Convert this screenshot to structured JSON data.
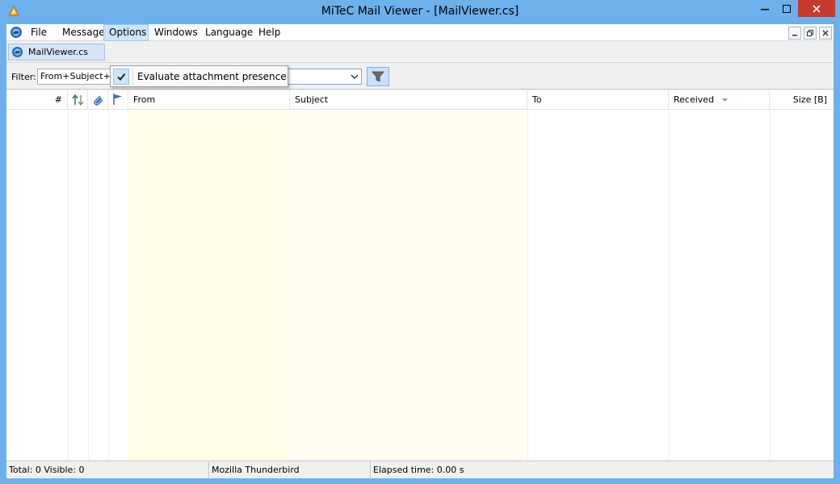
{
  "window": {
    "title": "MiTeC Mail Viewer - [MailViewer.cs]"
  },
  "menu": {
    "items": [
      "File",
      "Messages",
      "Options",
      "Windows",
      "Language",
      "Help"
    ],
    "active": "Options"
  },
  "options_menu": {
    "items": [
      {
        "label": "Evaluate attachment presence",
        "checked": true
      }
    ]
  },
  "tab": {
    "label": "MailViewer.cs"
  },
  "filter": {
    "label": "Filter:",
    "field_value": "From+Subject+To+Body",
    "search_value": ""
  },
  "grid": {
    "columns": [
      "#",
      "From",
      "Subject",
      "To",
      "Received",
      "Size [B]"
    ],
    "rows": []
  },
  "status": {
    "total_visible": "Total: 0   Visible: 0",
    "client": "Mozilla Thunderbird",
    "elapsed": "Elapsed time: 0.00 s"
  },
  "colors": {
    "titlebar": "#6cb0ec",
    "close_button": "#c7392d",
    "from_column": "#fffde7",
    "subject_column": "#fffcf2",
    "menu_highlight": "#cce4f7"
  },
  "icons": [
    "app-icon",
    "thunderbird-icon",
    "minimize-icon",
    "maximize-icon",
    "close-icon",
    "filter-funnel-icon",
    "sort-arrows-icon",
    "attachment-paperclip-icon",
    "flag-icon",
    "check-icon",
    "sort-desc-icon"
  ]
}
